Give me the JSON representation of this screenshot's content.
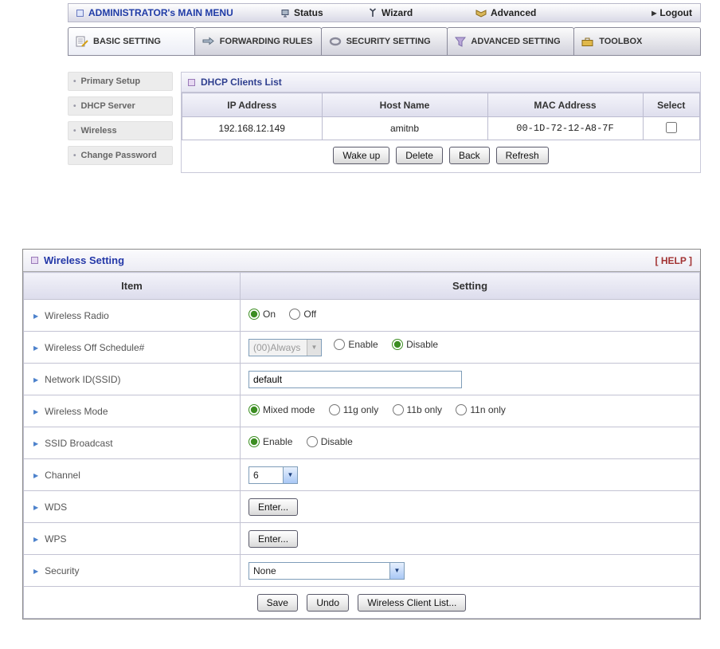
{
  "menubar": {
    "title": "ADMINISTRATOR's MAIN MENU",
    "status": "Status",
    "wizard": "Wizard",
    "advanced": "Advanced",
    "logout": "Logout"
  },
  "tabs": [
    {
      "label": "BASIC SETTING"
    },
    {
      "label": "FORWARDING RULES"
    },
    {
      "label": "SECURITY SETTING"
    },
    {
      "label": "ADVANCED SETTING"
    },
    {
      "label": "TOOLBOX"
    }
  ],
  "sidebar": [
    {
      "label": "Primary Setup"
    },
    {
      "label": "DHCP Server"
    },
    {
      "label": "Wireless"
    },
    {
      "label": "Change Password"
    }
  ],
  "dhcp_list": {
    "title": "DHCP Clients List",
    "columns": [
      "IP Address",
      "Host Name",
      "MAC Address",
      "Select"
    ],
    "row": {
      "ip": "192.168.12.149",
      "host": "amitnb",
      "mac": "00-1D-72-12-A8-7F"
    },
    "buttons": {
      "wakeup": "Wake up",
      "delete": "Delete",
      "back": "Back",
      "refresh": "Refresh"
    }
  },
  "wireless": {
    "title": "Wireless Setting",
    "help": "[ HELP ]",
    "header": {
      "item": "Item",
      "setting": "Setting"
    },
    "radio": {
      "label": "Wireless Radio",
      "on": "On",
      "off": "Off",
      "selected": "On"
    },
    "schedule": {
      "label": "Wireless Off Schedule#",
      "value": "(00)Always",
      "enable": "Enable",
      "disable": "Disable",
      "selected": "Disable"
    },
    "ssid": {
      "label": "Network ID(SSID)",
      "value": "default"
    },
    "mode": {
      "label": "Wireless Mode",
      "mixed": "Mixed mode",
      "g": "11g only",
      "b": "11b only",
      "n": "11n only",
      "selected": "Mixed mode"
    },
    "broadcast": {
      "label": "SSID Broadcast",
      "enable": "Enable",
      "disable": "Disable",
      "selected": "Enable"
    },
    "channel": {
      "label": "Channel",
      "value": "6"
    },
    "wds": {
      "label": "WDS",
      "button": "Enter..."
    },
    "wps": {
      "label": "WPS",
      "button": "Enter..."
    },
    "security": {
      "label": "Security",
      "value": "None"
    },
    "actions": {
      "save": "Save",
      "undo": "Undo",
      "client_list": "Wireless Client List..."
    }
  }
}
